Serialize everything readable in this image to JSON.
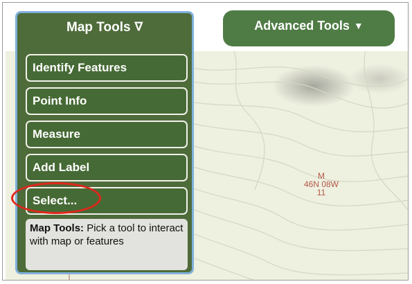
{
  "map_tools": {
    "title": "Map Tools",
    "caret": "∇",
    "items": [
      {
        "label": "Identify Features"
      },
      {
        "label": "Point Info"
      },
      {
        "label": "Measure"
      },
      {
        "label": "Add Label"
      },
      {
        "label": "Select..."
      }
    ],
    "help": {
      "heading": "Map Tools:",
      "text": "Pick a tool to interact with map or features"
    }
  },
  "advanced_tools": {
    "label": "Advanced Tools",
    "caret": "▼"
  },
  "map": {
    "section_label": {
      "line1": "M",
      "line2": "46N 08W",
      "line3": "11"
    }
  },
  "colors": {
    "panel_green": "#4e6b3a",
    "button_green": "#4f7c45",
    "highlight_red": "#e1261c",
    "panel_border_blue": "#7fb0da",
    "section_label_color": "#b4574a"
  },
  "icons": {
    "map_tools_caret": "down-triangle-outline-icon",
    "advanced_tools_caret": "down-triangle-solid-icon"
  }
}
